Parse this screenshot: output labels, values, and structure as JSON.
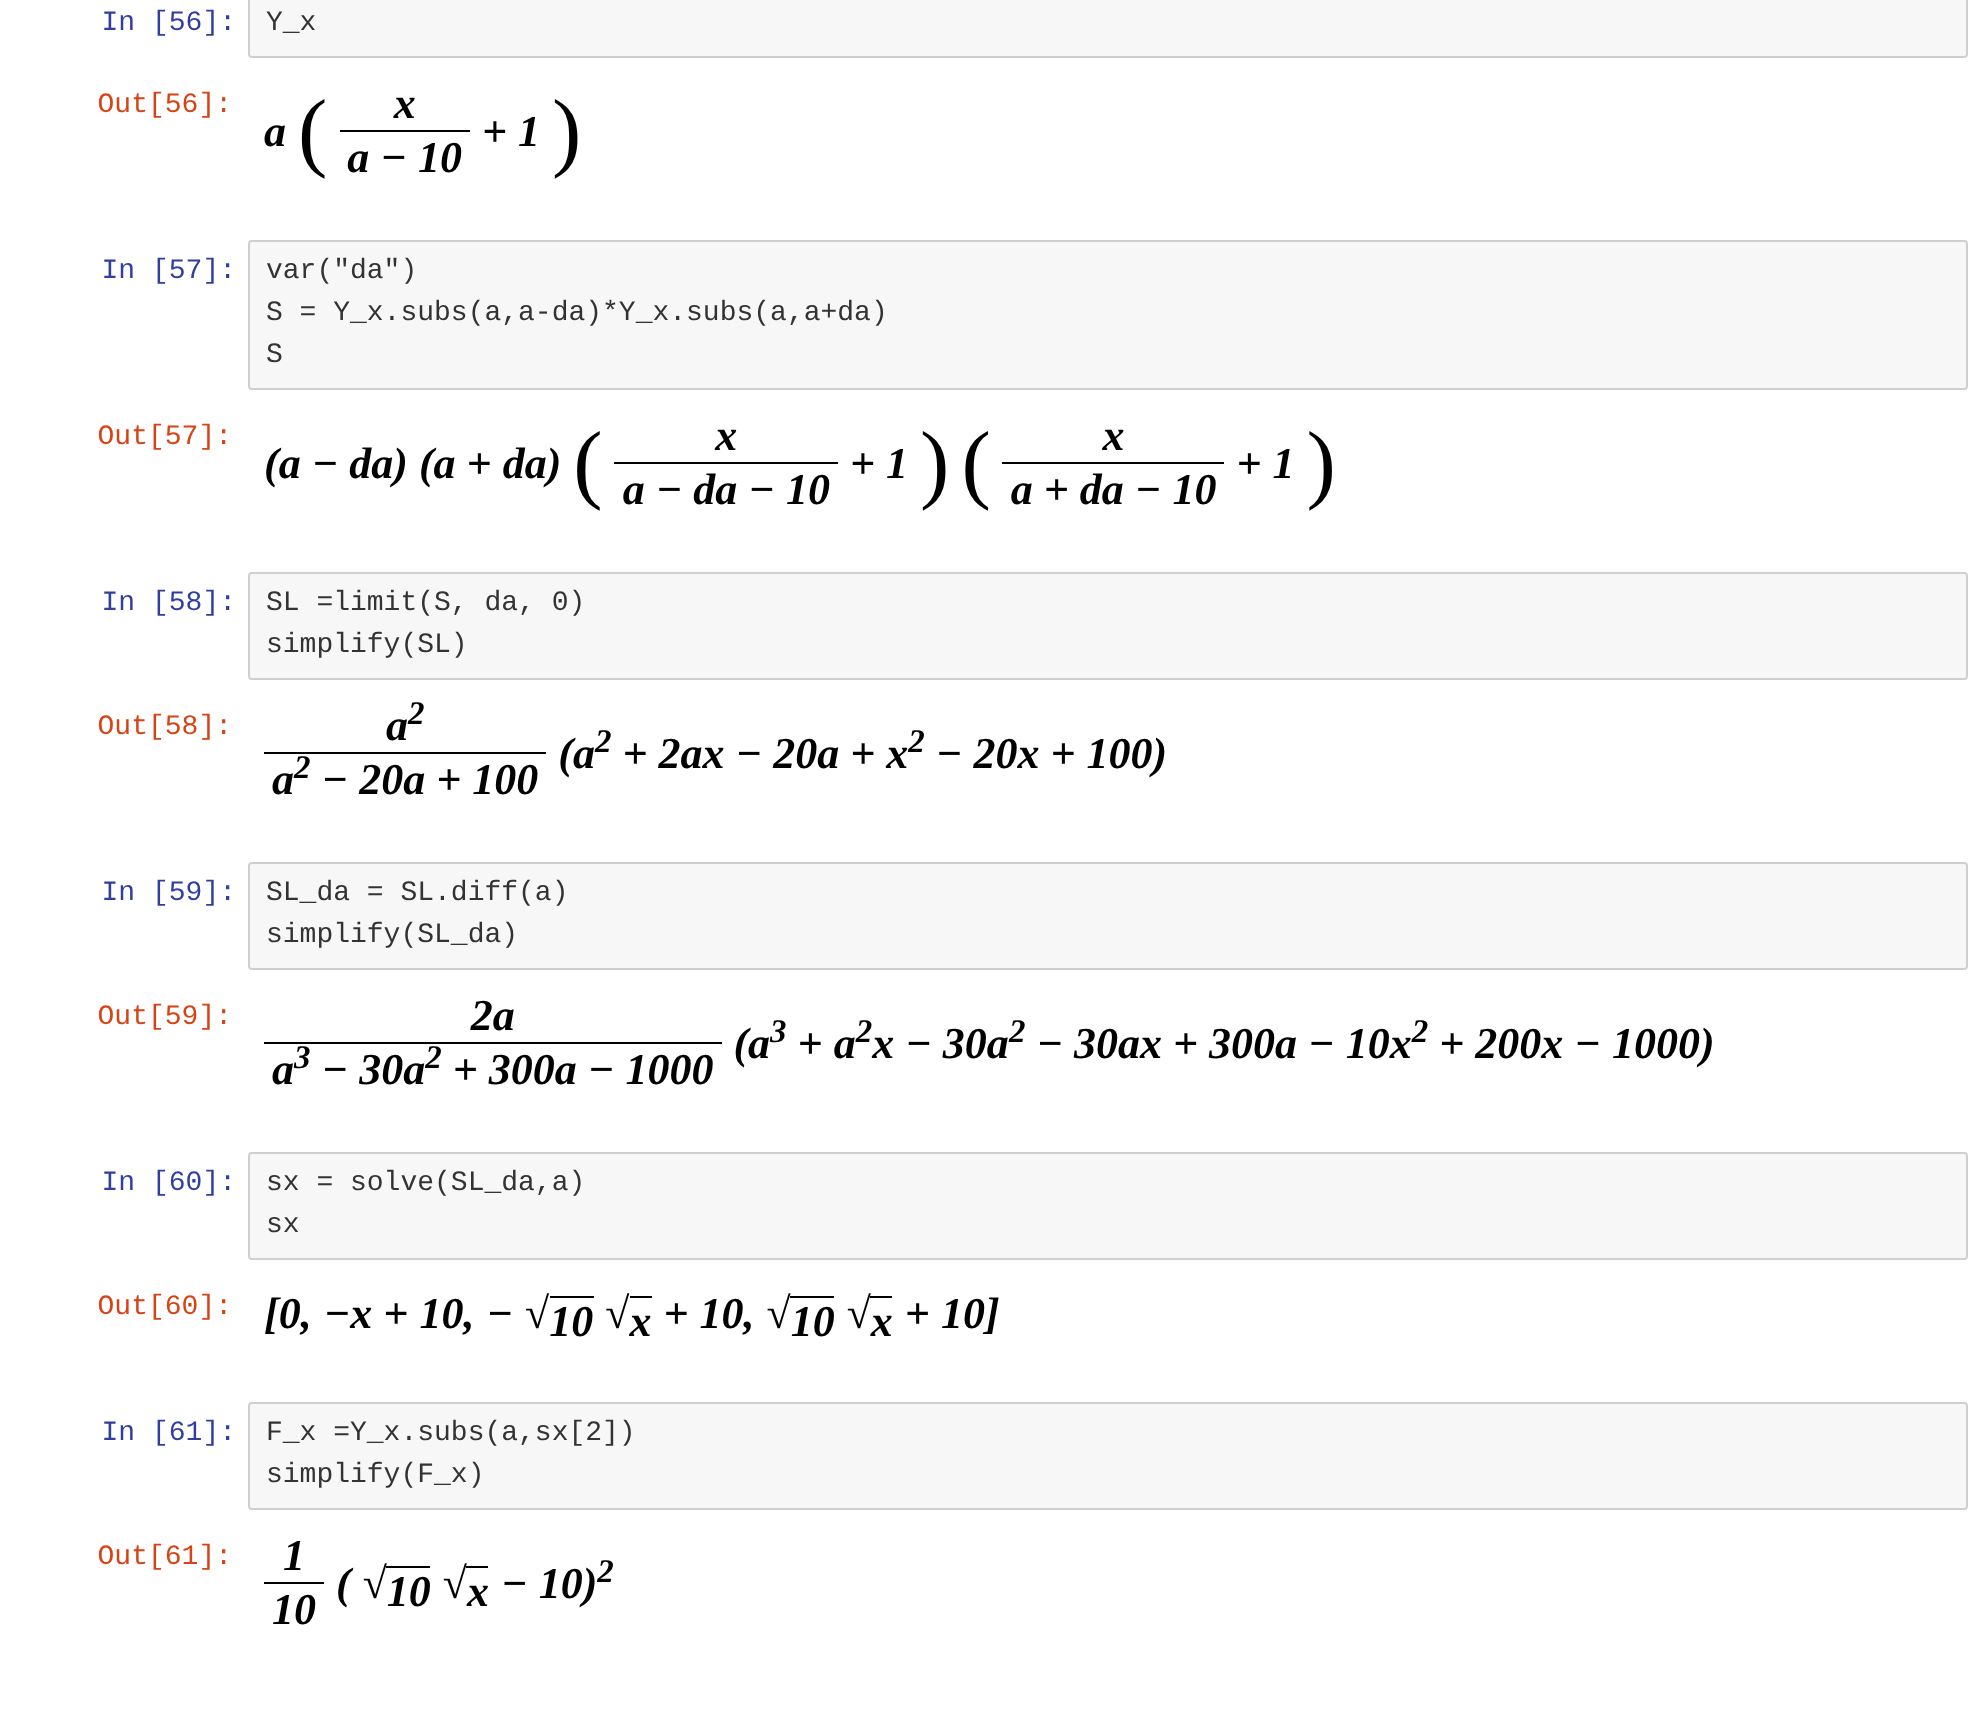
{
  "cells": [
    {
      "in_prompt": "In [56]:",
      "code": [
        "Y_x"
      ],
      "out_prompt": "Out[56]:",
      "math": [
        {
          "kind": "text",
          "text": "a"
        },
        {
          "kind": "paren",
          "text": "("
        },
        {
          "kind": "frac",
          "num": "x",
          "den": "a − 10"
        },
        {
          "kind": "text",
          "text": "+ 1"
        },
        {
          "kind": "paren",
          "text": ")"
        }
      ]
    },
    {
      "in_prompt": "In [57]:",
      "code": [
        "var(\"da\")",
        "S = Y_x.subs(a,a-da)*Y_x.subs(a,a+da)",
        "S"
      ],
      "out_prompt": "Out[57]:",
      "math": [
        {
          "kind": "text",
          "text": "(a − da) (a + da)"
        },
        {
          "kind": "paren",
          "text": "("
        },
        {
          "kind": "frac",
          "num": "x",
          "den": "a − da − 10"
        },
        {
          "kind": "text",
          "text": "+ 1"
        },
        {
          "kind": "paren",
          "text": ")"
        },
        {
          "kind": "paren",
          "text": "("
        },
        {
          "kind": "frac",
          "num": "x",
          "den": "a + da − 10"
        },
        {
          "kind": "text",
          "text": "+ 1"
        },
        {
          "kind": "paren",
          "text": ")"
        }
      ]
    },
    {
      "in_prompt": "In [58]:",
      "code": [
        "SL =limit(S, da, 0)",
        "simplify(SL)"
      ],
      "out_prompt": "Out[58]:",
      "math": [
        {
          "kind": "frac",
          "num": "a$^{2}$",
          "den": "a$^{2}$ − 20a + 100"
        },
        {
          "kind": "text",
          "text": "(a$^{2}$ + 2ax − 20a + x$^{2}$ − 20x + 100)"
        }
      ]
    },
    {
      "in_prompt": "In [59]:",
      "code": [
        "SL_da = SL.diff(a)",
        "simplify(SL_da)"
      ],
      "out_prompt": "Out[59]:",
      "math": [
        {
          "kind": "frac",
          "num": "2a",
          "den": "a$^{3}$ − 30a$^{2}$ + 300a − 1000"
        },
        {
          "kind": "text",
          "text": "(a$^{3}$ + a$^{2}$x − 30a$^{2}$ − 30ax + 300a − 10x$^{2}$ + 200x − 1000)"
        }
      ]
    },
    {
      "in_prompt": "In [60]:",
      "code": [
        "sx = solve(SL_da,a)",
        "sx"
      ],
      "out_prompt": "Out[60]:",
      "math": [
        {
          "kind": "text",
          "text": "[0,"
        },
        {
          "kind": "text",
          "text": "−x + 10,"
        },
        {
          "kind": "text",
          "text": "−"
        },
        {
          "kind": "sqrt",
          "sign": "√",
          "radicand": "10"
        },
        {
          "kind": "sqrt",
          "sign": "√",
          "radicand": "x"
        },
        {
          "kind": "text",
          "text": "+ 10,"
        },
        {
          "kind": "sqrt",
          "sign": "√",
          "radicand": "10"
        },
        {
          "kind": "sqrt",
          "sign": "√",
          "radicand": "x"
        },
        {
          "kind": "text",
          "text": "+ 10]"
        }
      ]
    },
    {
      "in_prompt": "In [61]:",
      "code": [
        "F_x =Y_x.subs(a,sx[2])",
        "simplify(F_x)"
      ],
      "out_prompt": "Out[61]:",
      "math": [
        {
          "kind": "frac",
          "num": "1",
          "den": "10"
        },
        {
          "kind": "text",
          "text": "("
        },
        {
          "kind": "sqrt",
          "sign": "√",
          "radicand": "10"
        },
        {
          "kind": "sqrt",
          "sign": "√",
          "radicand": "x"
        },
        {
          "kind": "text",
          "text": "− 10)$^{2}$"
        }
      ]
    }
  ]
}
